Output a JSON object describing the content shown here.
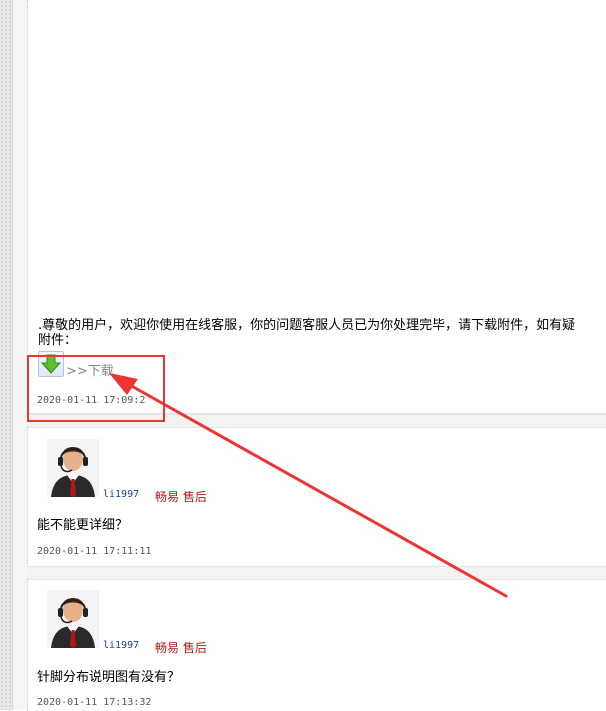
{
  "messages": [
    {
      "text": ".尊敬的用户，欢迎你使用在线客服，你的问题客服人员已为你处理完毕，请下载附件，如有疑",
      "text_wrap": "附件：",
      "download_label": ">>下载",
      "time": "2020-01-11 17:09:2"
    },
    {
      "username": "li1997",
      "role": "畅易 售后",
      "text": "能不能更详细？",
      "time": "2020-01-11 17:11:11"
    },
    {
      "username": "li1997",
      "role": "畅易 售后",
      "text": "针脚分布说明图有没有？",
      "time": "2020-01-11 17:13:32"
    }
  ],
  "icons": {
    "avatar": "customer-service-agent-icon",
    "download": "download-arrow-icon"
  },
  "colors": {
    "annotation": "#ee3333",
    "username": "#1a3f8c",
    "role": "#b21a1a"
  }
}
